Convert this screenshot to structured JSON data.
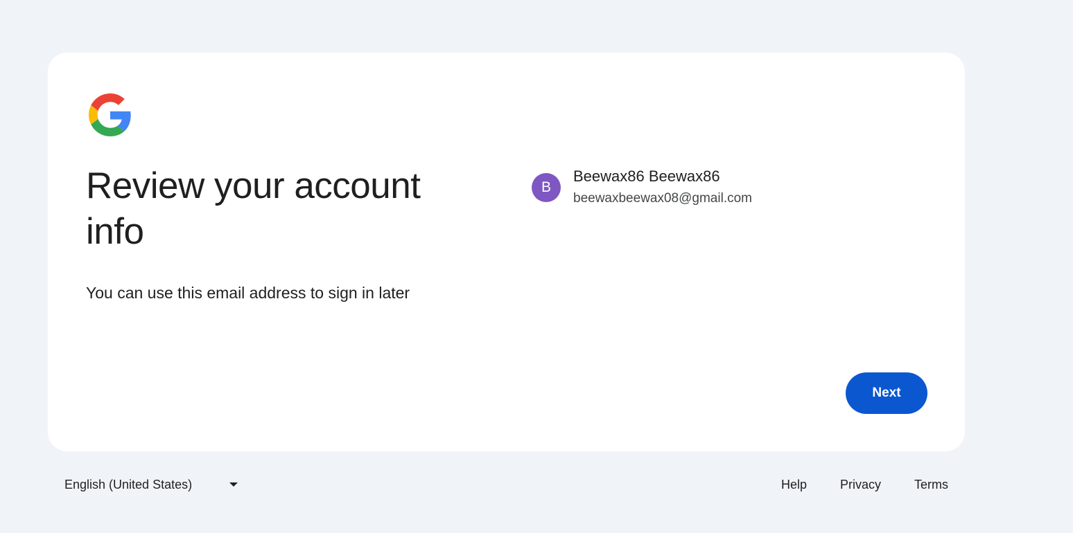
{
  "card": {
    "heading": "Review your account info",
    "subtitle": "You can use this email address to sign in later"
  },
  "account": {
    "avatar_initial": "B",
    "avatar_color": "#7e57c2",
    "name": "Beewax86 Beewax86",
    "email": "beewaxbeewax08@gmail.com"
  },
  "actions": {
    "next_label": "Next",
    "accent_color": "#0b57d0"
  },
  "footer": {
    "language": "English (United States)",
    "language_icon": "chevron-down-icon",
    "links": [
      "Help",
      "Privacy",
      "Terms"
    ]
  },
  "logo": {
    "icon": "google-g-logo"
  }
}
